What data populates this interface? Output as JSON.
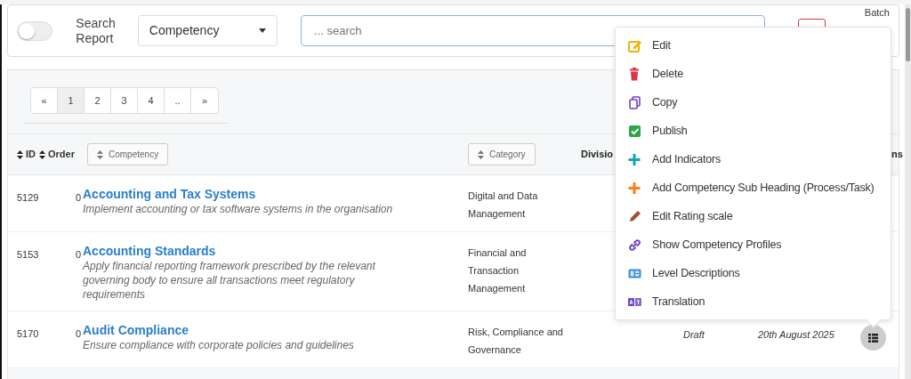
{
  "toggle": {
    "label": "Search Report",
    "on": false
  },
  "filter_select": {
    "value": "Competency"
  },
  "search": {
    "placeholder": "... search"
  },
  "batch_label": "Batch",
  "pagination": [
    {
      "label": "«",
      "selected": false
    },
    {
      "label": "1",
      "selected": true
    },
    {
      "label": "2",
      "selected": false
    },
    {
      "label": "3",
      "selected": false
    },
    {
      "label": "4",
      "selected": false
    },
    {
      "label": "..",
      "selected": false
    },
    {
      "label": "»",
      "selected": false
    }
  ],
  "table": {
    "columns": [
      {
        "label": "ID",
        "kind": "sort-text"
      },
      {
        "label": "Order",
        "kind": "sort-text"
      },
      {
        "label": "Competency",
        "kind": "sort-button"
      },
      {
        "label": "Category",
        "kind": "sort-button"
      },
      {
        "label": "Divisio",
        "kind": "plain"
      },
      {
        "label": "ns",
        "kind": "plain"
      }
    ],
    "rows": [
      {
        "id": "5129",
        "order": "0",
        "title": "Accounting and Tax Systems",
        "description": "Implement accounting or tax software systems in the organisation",
        "category": "Digital and Data Management"
      },
      {
        "id": "5153",
        "order": "0",
        "title": "Accounting Standards",
        "description": "Apply financial reporting framework prescribed by the relevant governing body to ensure all transactions meet regulatory requirements",
        "category": "Financial and Transaction Management"
      },
      {
        "id": "5170",
        "order": "0",
        "title": "Audit Compliance",
        "description": "Ensure compliance with corporate policies and guidelines",
        "category": "Risk, Compliance and Governance",
        "status": "Draft",
        "date": "20th August 2025",
        "has_action": true
      }
    ]
  },
  "menu": [
    {
      "label": "Edit",
      "kind": "edit"
    },
    {
      "label": "Delete",
      "kind": "delete"
    },
    {
      "label": "Copy",
      "kind": "copy"
    },
    {
      "label": "Publish",
      "kind": "publish"
    },
    {
      "label": "Add Indicators",
      "kind": "add",
      "color": "#17a2b8"
    },
    {
      "label": "Add Competency Sub Heading (Process/Task)",
      "kind": "add",
      "color": "#fd7e14"
    },
    {
      "label": "Edit Rating scale",
      "kind": "rating"
    },
    {
      "label": "Show Competency Profiles",
      "kind": "profiles"
    },
    {
      "label": "Level Descriptions",
      "kind": "levels"
    },
    {
      "label": "Translation",
      "kind": "translate"
    }
  ]
}
